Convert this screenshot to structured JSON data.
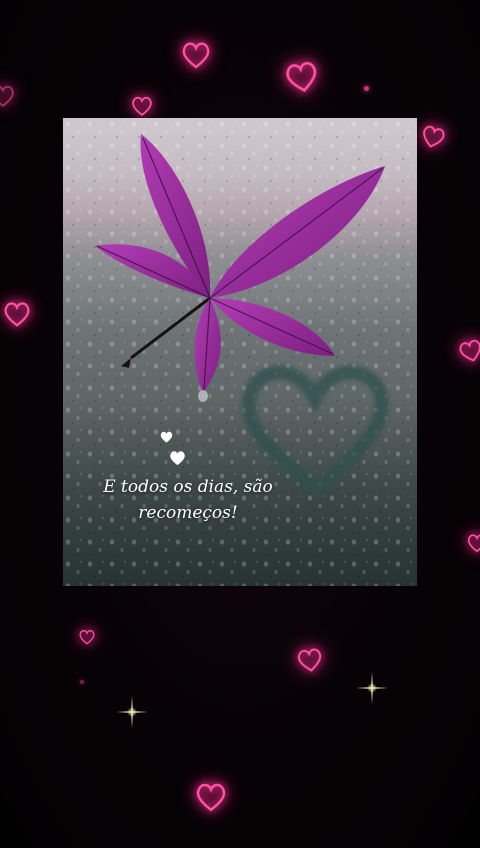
{
  "caption": {
    "line1": "E todos os dias, são",
    "line2": "recomeços!"
  },
  "colors": {
    "background": "#050104",
    "neon_pink": "#ff4fa6",
    "leaf_purple": "#9b2a9c",
    "caption_text": "#ffffff"
  },
  "icons": {
    "decor": "heart-outline-icon",
    "small_hearts": "small-white-heart-icon",
    "sparkle": "sparkle-star-icon"
  }
}
